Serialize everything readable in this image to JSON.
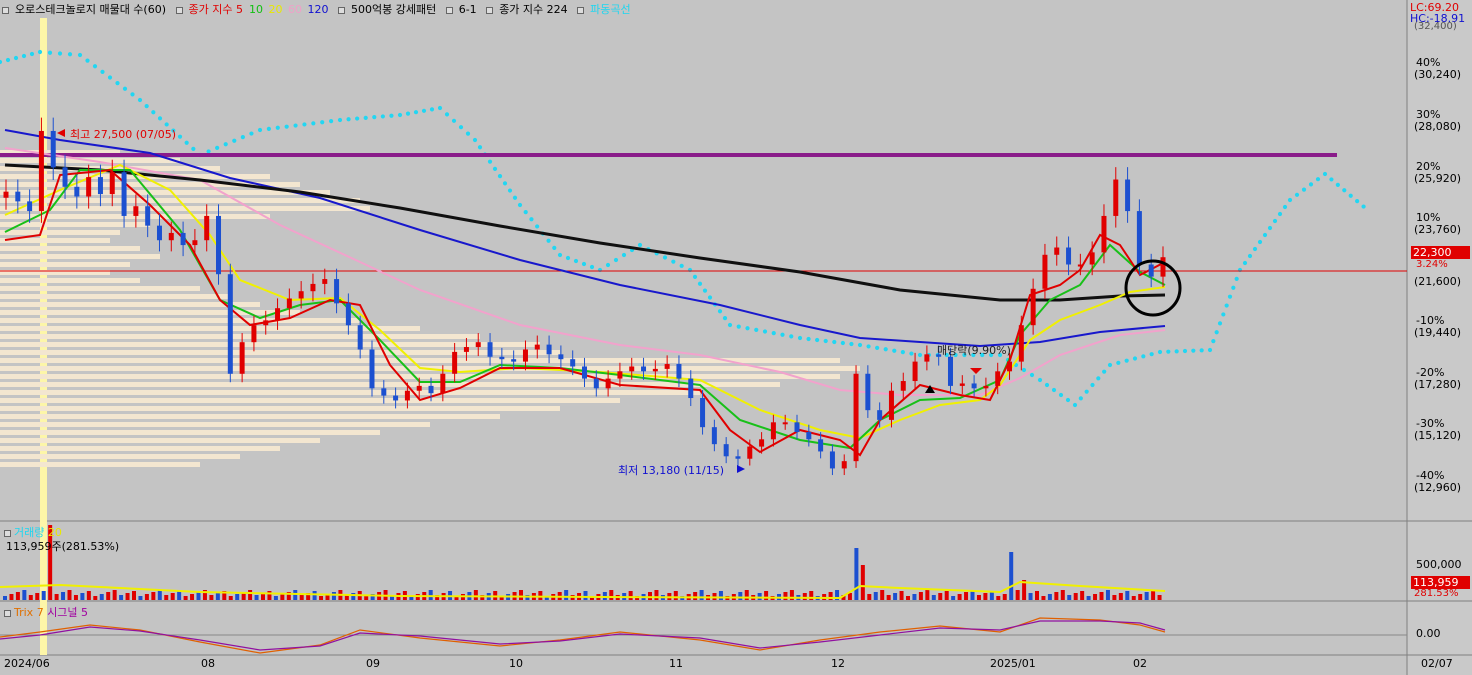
{
  "legend": {
    "title": "오로스테크놀로지 매물대 수(60)",
    "ma_label": "종가 지수 5",
    "ma_10": "10",
    "ma_20": "20",
    "ma_60": "60",
    "ma_120": "120",
    "pattern": "500억봉 강세패턴",
    "code": "6-1",
    "ma224": "종가 지수 224",
    "wave": "파동곡선"
  },
  "top_right": {
    "lc": "LC:69.20",
    "hc": "HC:-18.91",
    "hc_sub": "(32,400)"
  },
  "annotations": {
    "high": "최고 27,500 (07/05)",
    "low": "최저 13,180 (11/15)",
    "event": "매당락(9.90%)"
  },
  "price_badge": {
    "price": "22,300",
    "pct": "3.24%"
  },
  "volume_panel": {
    "title": "거래량",
    "ma": "20",
    "value": "113,959주(281.53%)",
    "axis": "500,000",
    "badge": "113,959",
    "badge_pct": "281.53%"
  },
  "trix_panel": {
    "title": "Trix 7",
    "signal": "시그널 5",
    "axis": "0.00"
  },
  "x_axis": [
    "2024/06",
    "08",
    "09",
    "10",
    "11",
    "12",
    "2025/01",
    "02",
    "02/07"
  ],
  "chart_data": {
    "type": "candlestick",
    "title": "오로스테크놀로지",
    "y_axis_ticks": [
      {
        "pct": "40%",
        "price": "(30,240)"
      },
      {
        "pct": "30%",
        "price": "(28,080)"
      },
      {
        "pct": "20%",
        "price": "(25,920)"
      },
      {
        "pct": "10%",
        "price": "(23,760)"
      },
      {
        "pct": "",
        "price": "(21,600)"
      },
      {
        "pct": "-10%",
        "price": "(19,440)"
      },
      {
        "pct": "-20%",
        "price": "(17,280)"
      },
      {
        "pct": "-30%",
        "price": "(15,120)"
      },
      {
        "pct": "-40%",
        "price": "(12,960)"
      }
    ],
    "ylim": [
      12300,
      32400
    ],
    "close_path": [
      25000,
      24600,
      24200,
      27500,
      26000,
      25200,
      24800,
      25600,
      24900,
      25800,
      24000,
      24400,
      23600,
      23000,
      23300,
      22800,
      23000,
      24000,
      21600,
      17500,
      18800,
      19500,
      19700,
      20200,
      20600,
      20900,
      21200,
      21400,
      20400,
      19500,
      18500,
      16900,
      16600,
      16400,
      16800,
      17000,
      16700,
      17500,
      18400,
      18600,
      18800,
      18200,
      18100,
      18000,
      18500,
      18700,
      18300,
      18100,
      17800,
      17300,
      16900,
      17300,
      17600,
      17800,
      17600,
      17700,
      17900,
      17300,
      16500,
      15300,
      14600,
      14100,
      14000,
      14500,
      14800,
      15500,
      15500,
      15100,
      14800,
      14300,
      13600,
      13900,
      17500,
      16000,
      15600,
      16800,
      17200,
      18000,
      18300,
      18200,
      17000,
      17100,
      16900,
      17000,
      17600,
      18000,
      19500,
      21000,
      22400,
      22700,
      22000,
      22000,
      22500,
      24000,
      25500,
      24200,
      22000,
      21500,
      22300
    ],
    "ma224_path": [
      24900,
      24700,
      24500,
      24300,
      24100,
      23900,
      23700,
      23500,
      23300,
      23100,
      22900,
      22800,
      22700,
      22600,
      22500,
      22400,
      22300,
      22200,
      22100,
      22000,
      21900,
      21900,
      21900,
      21800,
      21800
    ],
    "volume_spikes": [
      500000,
      480000,
      120000,
      460000,
      140000
    ],
    "resistance_price": 26200,
    "current_price": 22300
  }
}
